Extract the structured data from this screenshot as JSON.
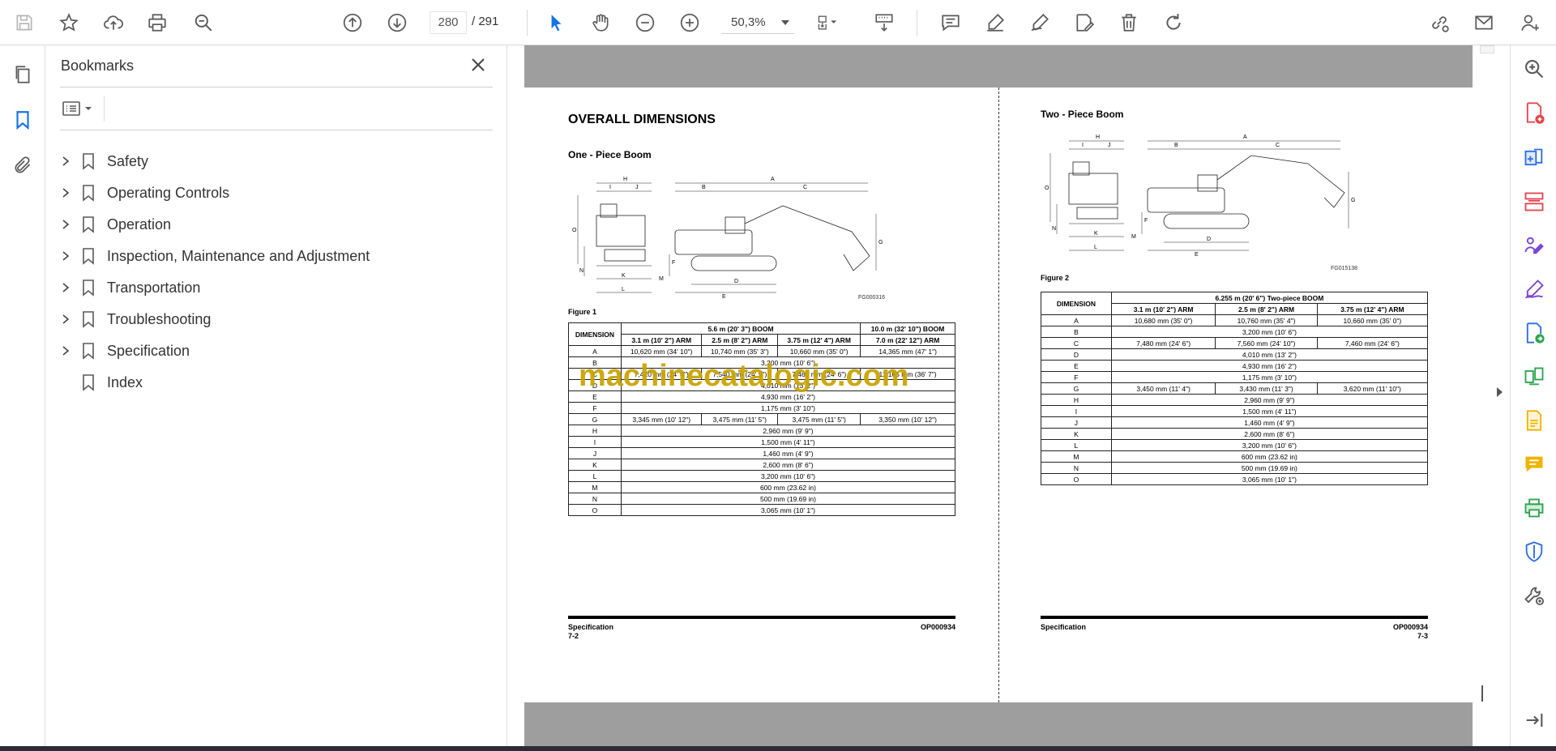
{
  "toolbar": {
    "page_current": "280",
    "page_total": "/  291",
    "zoom": "50,3%"
  },
  "bookmarks": {
    "title": "Bookmarks",
    "items": [
      {
        "label": "Safety",
        "expandable": true
      },
      {
        "label": "Operating Controls",
        "expandable": true
      },
      {
        "label": "Operation",
        "expandable": true
      },
      {
        "label": "Inspection, Maintenance and Adjustment",
        "expandable": true
      },
      {
        "label": "Transportation",
        "expandable": true
      },
      {
        "label": "Troubleshooting",
        "expandable": true
      },
      {
        "label": "Specification",
        "expandable": true
      },
      {
        "label": "Index",
        "expandable": false
      }
    ]
  },
  "left_page": {
    "heading": "OVERALL DIMENSIONS",
    "subheading": "One - Piece Boom",
    "figure_code": "FG000316",
    "figure_caption": "Figure 1",
    "table": {
      "corner": "DIMENSION",
      "group1": "5.6 m (20' 3\") BOOM",
      "group2": "10.0 m (32' 10\") BOOM",
      "cols": [
        "3.1 m (10' 2\") ARM",
        "2.5 m (8' 2\") ARM",
        "3.75 m (12' 4\") ARM",
        "7.0 m (22' 12\") ARM"
      ],
      "rows": [
        {
          "dim": "A",
          "cells": [
            "10,620 mm (34' 10\")",
            "10,740 mm (35' 3\")",
            "10,660 mm (35' 0\")",
            "14,365 mm (47' 1\")"
          ]
        },
        {
          "dim": "B",
          "span": "3,200 mm (10' 6\")"
        },
        {
          "dim": "C",
          "cells": [
            "7,420 mm (24' 4\")",
            "7,540 mm (24' 9\")",
            "7,460 mm (24' 6\")",
            "11,165 mm (36' 7\")"
          ]
        },
        {
          "dim": "D",
          "span": "4,010 mm (13' 2\")"
        },
        {
          "dim": "E",
          "span": "4,930 mm (16' 2\")"
        },
        {
          "dim": "F",
          "span": "1,175 mm (3' 10\")"
        },
        {
          "dim": "G",
          "cells": [
            "3,345 mm (10' 12\")",
            "3,475 mm (11' 5\")",
            "3,475 mm (11' 5\")",
            "3,350 mm (10' 12\")"
          ]
        },
        {
          "dim": "H",
          "span": "2,960 mm (9' 9\")"
        },
        {
          "dim": "I",
          "span": "1,500 mm (4' 11\")"
        },
        {
          "dim": "J",
          "span": "1,460 mm (4' 9\")"
        },
        {
          "dim": "K",
          "span": "2,600 mm (8' 6\")"
        },
        {
          "dim": "L",
          "span": "3,200 mm (10' 6\")"
        },
        {
          "dim": "M",
          "span": "600 mm (23.62 in)"
        },
        {
          "dim": "N",
          "span": "500 mm (19.69 in)"
        },
        {
          "dim": "O",
          "span": "3,065 mm (10' 1\")"
        }
      ]
    },
    "footer_left": "Specification",
    "footer_page": "7-2",
    "footer_code": "OP000934"
  },
  "right_page": {
    "heading": "Two - Piece Boom",
    "figure_code": "FG015138",
    "figure_caption": "Figure 2",
    "table": {
      "corner": "DIMENSION",
      "group": "6.255 m (20' 6\") Two-piece BOOM",
      "cols": [
        "3.1 m (10' 2\") ARM",
        "2.5 m (8' 2\") ARM",
        "3.75 m (12' 4\") ARM"
      ],
      "rows": [
        {
          "dim": "A",
          "cells": [
            "10,680 mm (35' 0\")",
            "10,760 mm (35' 4\")",
            "10,660 mm (35' 0\")"
          ]
        },
        {
          "dim": "B",
          "span": "3,200 mm (10' 6\")"
        },
        {
          "dim": "C",
          "cells": [
            "7,480 mm (24' 6\")",
            "7,560 mm (24' 10\")",
            "7,460 mm (24' 6\")"
          ]
        },
        {
          "dim": "D",
          "span": "4,010 mm (13' 2\")"
        },
        {
          "dim": "E",
          "span": "4,930 mm (16' 2\")"
        },
        {
          "dim": "F",
          "span": "1,175 mm (3' 10\")"
        },
        {
          "dim": "G",
          "cells": [
            "3,450 mm (11' 4\")",
            "3,430 mm (11' 3\")",
            "3,620 mm (11' 10\")"
          ]
        },
        {
          "dim": "H",
          "span": "2,960 mm (9' 9\")"
        },
        {
          "dim": "I",
          "span": "1,500 mm (4' 11\")"
        },
        {
          "dim": "J",
          "span": "1,460 mm (4' 9\")"
        },
        {
          "dim": "K",
          "span": "2,600 mm (8' 6\")"
        },
        {
          "dim": "L",
          "span": "3,200 mm (10' 6\")"
        },
        {
          "dim": "M",
          "span": "600 mm (23.62 in)"
        },
        {
          "dim": "N",
          "span": "500 mm (19.69 in)"
        },
        {
          "dim": "O",
          "span": "3,065 mm (10' 1\")"
        }
      ]
    },
    "footer_left": "Specification",
    "footer_page": "7-3",
    "footer_code": "OP000934"
  },
  "watermark": "machinecatalogic.com",
  "figure_labels": [
    "A",
    "B",
    "C",
    "D",
    "E",
    "F",
    "G",
    "H",
    "I",
    "J",
    "K",
    "L",
    "M",
    "N",
    "O"
  ],
  "colors": {
    "accent": "#1473e6",
    "icon_gray": "#5a5a5a",
    "watermark": "#c9a300",
    "page_gray": "#9e9e9e",
    "tool_red": "#e34850",
    "tool_purple": "#7a45d6",
    "tool_blue": "#2d6fe6",
    "tool_green": "#2ea44f",
    "tool_yellow": "#f0b400"
  },
  "icons": {
    "toolbar": [
      "save-icon",
      "star-icon",
      "upload-icon",
      "print-icon",
      "find-icon",
      "prev-page-icon",
      "next-page-icon",
      "select-icon",
      "hand-icon",
      "zoom-out-icon",
      "zoom-in-icon",
      "fit-page-icon",
      "scroll-mode-icon",
      "comment-icon",
      "highlight-icon",
      "sign-icon",
      "fill-sign-icon",
      "delete-icon",
      "rotate-icon",
      "share-link-icon",
      "email-icon",
      "account-icon"
    ],
    "right_rail": [
      "zoom-search-icon",
      "create-pdf-icon",
      "export-pdf-icon",
      "organize-pages-icon",
      "fill-sign-tool-icon",
      "edit-pdf-icon",
      "send-review-icon",
      "compare-icon",
      "scan-icon",
      "comment-tool-icon",
      "print-production-icon",
      "protect-icon",
      "more-tools-icon",
      "expand-panel-icon"
    ]
  }
}
